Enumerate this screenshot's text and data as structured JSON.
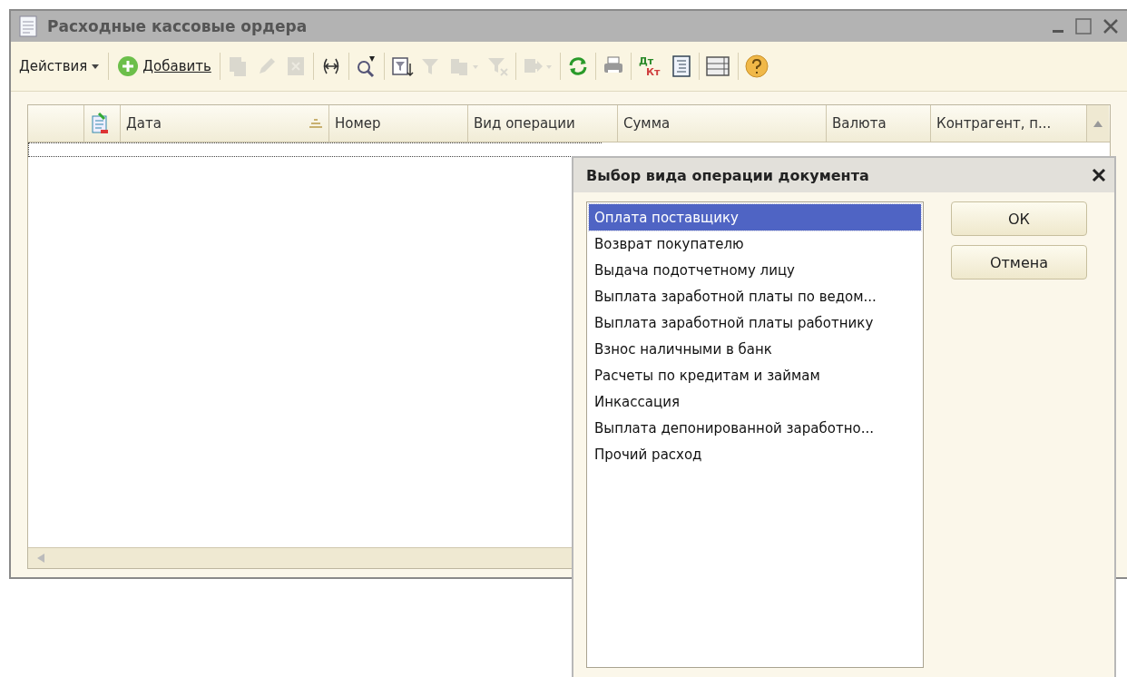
{
  "window": {
    "title": "Расходные кассовые ордера"
  },
  "toolbar": {
    "actions": "Действия",
    "add": "Добавить",
    "icons": [
      {
        "kind": "copy",
        "disabled": true
      },
      {
        "kind": "edit",
        "disabled": true
      },
      {
        "kind": "delete",
        "disabled": true
      },
      {
        "kind": "separator"
      },
      {
        "kind": "interval",
        "disabled": false
      },
      {
        "kind": "separator"
      },
      {
        "kind": "find",
        "disabled": false
      },
      {
        "kind": "separator"
      },
      {
        "kind": "filter",
        "disabled": false
      },
      {
        "kind": "funnel",
        "disabled": true
      },
      {
        "kind": "funnels",
        "disabled": true
      },
      {
        "kind": "unfilter",
        "disabled": true
      },
      {
        "kind": "separator"
      },
      {
        "kind": "linked",
        "disabled": true
      },
      {
        "kind": "separator"
      },
      {
        "kind": "refresh",
        "disabled": false
      },
      {
        "kind": "separator"
      },
      {
        "kind": "print",
        "disabled": false
      },
      {
        "kind": "separator"
      },
      {
        "kind": "journal",
        "disabled": false,
        "top": "Дт",
        "bottom": "Кт"
      },
      {
        "kind": "report",
        "disabled": false
      },
      {
        "kind": "separator"
      },
      {
        "kind": "columns",
        "disabled": false
      },
      {
        "kind": "separator"
      },
      {
        "kind": "help",
        "disabled": false
      }
    ]
  },
  "table": {
    "columns": [
      {
        "label": "Дата",
        "sorted": true
      },
      {
        "label": "Номер",
        "sorted": false
      },
      {
        "label": "Вид операции",
        "sorted": false
      },
      {
        "label": "Сумма",
        "sorted": false
      },
      {
        "label": "Валюта",
        "sorted": false
      },
      {
        "label": "Контрагент, п...",
        "sorted": false
      }
    ]
  },
  "dialog": {
    "title": "Выбор вида операции документа",
    "items": [
      {
        "label": "Оплата поставщику",
        "selected": true
      },
      {
        "label": "Возврат покупателю",
        "selected": false
      },
      {
        "label": "Выдача подотчетному лицу",
        "selected": false
      },
      {
        "label": "Выплата заработной платы по ведом...",
        "selected": false
      },
      {
        "label": "Выплата заработной платы работнику",
        "selected": false
      },
      {
        "label": "Взнос наличными в банк",
        "selected": false
      },
      {
        "label": "Расчеты по кредитам и займам",
        "selected": false
      },
      {
        "label": "Инкассация",
        "selected": false
      },
      {
        "label": "Выплата депонированной заработно...",
        "selected": false
      },
      {
        "label": "Прочий расход",
        "selected": false
      }
    ],
    "buttons": [
      "ОК",
      "Отмена"
    ]
  }
}
